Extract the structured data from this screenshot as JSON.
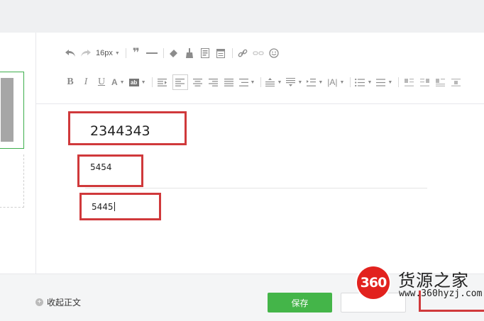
{
  "toolbar": {
    "font_size": "16px",
    "bold": "B",
    "italic": "I",
    "underline": "U",
    "font_color": "A",
    "bg_color": "ab",
    "letter_spacing": "|A|",
    "icons": [
      "undo-icon",
      "redo-icon",
      "quote-icon",
      "horizontal-rule-icon",
      "clear-format-icon",
      "format-brush-icon",
      "insert-template-icon",
      "insert-table-icon",
      "link-icon",
      "unlink-icon",
      "emoji-icon",
      "indent-icon",
      "align-left-icon",
      "align-center-icon",
      "align-right-icon",
      "align-justify-icon",
      "line-height-icon",
      "paragraph-spacing-before-icon",
      "paragraph-spacing-after-icon",
      "first-line-indent-icon",
      "bullet-list-icon",
      "numbered-list-icon",
      "float-left-icon",
      "float-right-icon",
      "float-none-icon",
      "float-center-icon"
    ]
  },
  "content": {
    "line1": "2344343",
    "line2": "5454",
    "line3": "5445"
  },
  "footer": {
    "collapse_label": "收起正文",
    "save_label": "保存"
  },
  "watermark": {
    "badge": "360",
    "name": "货源之家",
    "url": "www.360hyzj.com"
  },
  "colors": {
    "accent_green": "#44b549",
    "annotation_red": "#d0393b",
    "watermark_red": "#e2221e"
  }
}
